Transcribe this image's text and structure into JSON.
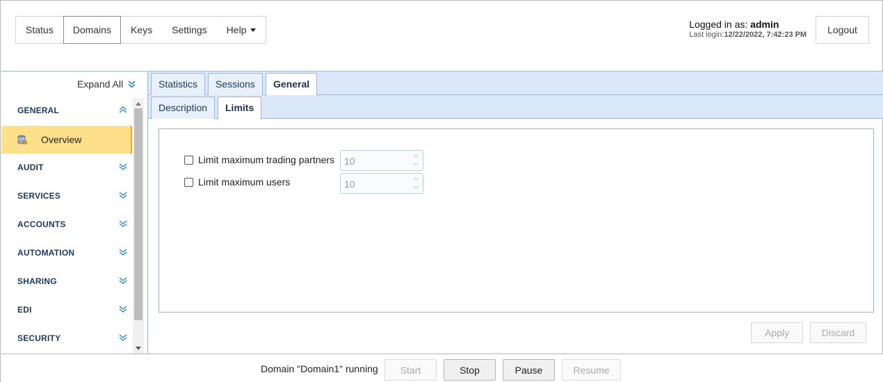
{
  "nav": {
    "items": [
      {
        "label": "Status"
      },
      {
        "label": "Domains",
        "active": true
      },
      {
        "label": "Keys"
      },
      {
        "label": "Settings"
      },
      {
        "label": "Help",
        "has_dropdown": true
      }
    ]
  },
  "session": {
    "logged_in_prefix": "Logged in as:",
    "username": "admin",
    "last_login_prefix": "Last login:",
    "last_login_value": "12/22/2022, 7:42:23 PM",
    "logout_label": "Logout"
  },
  "sidebar": {
    "expand_all_label": "Expand All",
    "sections": [
      {
        "label": "GENERAL",
        "expanded": true
      },
      {
        "label": "AUDIT",
        "expanded": false
      },
      {
        "label": "SERVICES",
        "expanded": false
      },
      {
        "label": "ACCOUNTS",
        "expanded": false
      },
      {
        "label": "AUTOMATION",
        "expanded": false
      },
      {
        "label": "SHARING",
        "expanded": false
      },
      {
        "label": "EDI",
        "expanded": false
      },
      {
        "label": "SECURITY",
        "expanded": false
      }
    ],
    "selected_item": {
      "label": "Overview",
      "icon": "database-icon"
    }
  },
  "tabs": {
    "main": [
      {
        "label": "Statistics"
      },
      {
        "label": "Sessions"
      },
      {
        "label": "General",
        "active": true
      }
    ],
    "sub": [
      {
        "label": "Description"
      },
      {
        "label": "Limits",
        "active": true
      }
    ]
  },
  "limits": {
    "trading_partners": {
      "label": "Limit maximum trading partners",
      "checked": false,
      "value": "10"
    },
    "users": {
      "label": "Limit maximum users",
      "checked": false,
      "value": "10"
    }
  },
  "actions": {
    "apply_label": "Apply",
    "discard_label": "Discard"
  },
  "footer": {
    "status": "Domain \"Domain1\" running",
    "start_label": "Start",
    "stop_label": "Stop",
    "pause_label": "Pause",
    "resume_label": "Resume"
  },
  "colors": {
    "accent_blue": "#2a86c9",
    "selected_bg": "#ffe08a",
    "tabbar_bg": "#dbe8fa",
    "border_blue": "#9ab7da"
  }
}
